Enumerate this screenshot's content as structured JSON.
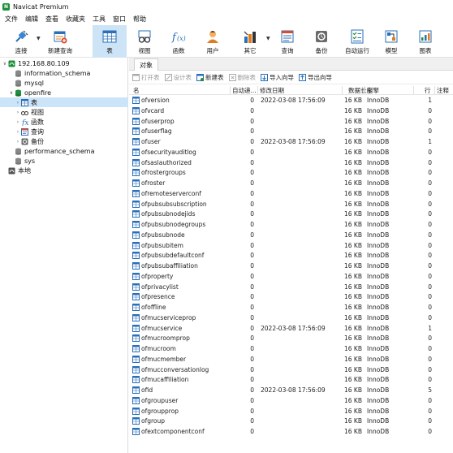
{
  "window": {
    "title": "Navicat Premium"
  },
  "menu": [
    "文件",
    "编辑",
    "查看",
    "收藏夹",
    "工具",
    "窗口",
    "帮助"
  ],
  "toolbar": {
    "connect": "连接",
    "new_query": "新建查询",
    "table": "表",
    "view": "视图",
    "function": "函数",
    "user": "用户",
    "other": "其它",
    "query": "查询",
    "backup": "备份",
    "automation": "自动运行",
    "model": "模型",
    "chart": "图表"
  },
  "sidebar": {
    "connection": "192.168.80.109",
    "databases": {
      "information_schema": "information_schema",
      "mysql": "mysql",
      "openfire": "openfire",
      "performance_schema": "performance_schema",
      "sys": "sys"
    },
    "openfire_children": {
      "tables": "表",
      "views": "视图",
      "functions": "函数",
      "queries": "查询",
      "backups": "备份"
    },
    "local": "本地"
  },
  "main": {
    "tab": "对象",
    "objbar": {
      "open": "打开表",
      "design": "设计表",
      "new": "新建表",
      "delete": "删除表",
      "import": "导入向导",
      "export": "导出向导"
    },
    "columns": {
      "name": "名",
      "auto_inc": "自动递...",
      "modified": "修改日期",
      "data_length": "数据长度",
      "engine": "引擎",
      "rows": "行",
      "comment": "注释"
    },
    "rows": [
      {
        "name": "ofversion",
        "auto": "0",
        "date": "2022-03-08 17:56:09",
        "size": "16 KB",
        "engine": "InnoDB",
        "rows": "1"
      },
      {
        "name": "ofvcard",
        "auto": "0",
        "date": "",
        "size": "16 KB",
        "engine": "InnoDB",
        "rows": "0"
      },
      {
        "name": "ofuserprop",
        "auto": "0",
        "date": "",
        "size": "16 KB",
        "engine": "InnoDB",
        "rows": "0"
      },
      {
        "name": "ofuserflag",
        "auto": "0",
        "date": "",
        "size": "16 KB",
        "engine": "InnoDB",
        "rows": "0"
      },
      {
        "name": "ofuser",
        "auto": "0",
        "date": "2022-03-08 17:56:09",
        "size": "16 KB",
        "engine": "InnoDB",
        "rows": "1"
      },
      {
        "name": "ofsecurityauditlog",
        "auto": "0",
        "date": "",
        "size": "16 KB",
        "engine": "InnoDB",
        "rows": "0"
      },
      {
        "name": "ofsaslauthorized",
        "auto": "0",
        "date": "",
        "size": "16 KB",
        "engine": "InnoDB",
        "rows": "0"
      },
      {
        "name": "ofrostergroups",
        "auto": "0",
        "date": "",
        "size": "16 KB",
        "engine": "InnoDB",
        "rows": "0"
      },
      {
        "name": "ofroster",
        "auto": "0",
        "date": "",
        "size": "16 KB",
        "engine": "InnoDB",
        "rows": "0"
      },
      {
        "name": "ofremoteserverconf",
        "auto": "0",
        "date": "",
        "size": "16 KB",
        "engine": "InnoDB",
        "rows": "0"
      },
      {
        "name": "ofpubsubsubscription",
        "auto": "0",
        "date": "",
        "size": "16 KB",
        "engine": "InnoDB",
        "rows": "0"
      },
      {
        "name": "ofpubsubnodejids",
        "auto": "0",
        "date": "",
        "size": "16 KB",
        "engine": "InnoDB",
        "rows": "0"
      },
      {
        "name": "ofpubsubnodegroups",
        "auto": "0",
        "date": "",
        "size": "16 KB",
        "engine": "InnoDB",
        "rows": "0"
      },
      {
        "name": "ofpubsubnode",
        "auto": "0",
        "date": "",
        "size": "16 KB",
        "engine": "InnoDB",
        "rows": "0"
      },
      {
        "name": "ofpubsubitem",
        "auto": "0",
        "date": "",
        "size": "16 KB",
        "engine": "InnoDB",
        "rows": "0"
      },
      {
        "name": "ofpubsubdefaultconf",
        "auto": "0",
        "date": "",
        "size": "16 KB",
        "engine": "InnoDB",
        "rows": "0"
      },
      {
        "name": "ofpubsubaffiliation",
        "auto": "0",
        "date": "",
        "size": "16 KB",
        "engine": "InnoDB",
        "rows": "0"
      },
      {
        "name": "ofproperty",
        "auto": "0",
        "date": "",
        "size": "16 KB",
        "engine": "InnoDB",
        "rows": "0"
      },
      {
        "name": "ofprivacylist",
        "auto": "0",
        "date": "",
        "size": "16 KB",
        "engine": "InnoDB",
        "rows": "0"
      },
      {
        "name": "ofpresence",
        "auto": "0",
        "date": "",
        "size": "16 KB",
        "engine": "InnoDB",
        "rows": "0"
      },
      {
        "name": "ofoffline",
        "auto": "0",
        "date": "",
        "size": "16 KB",
        "engine": "InnoDB",
        "rows": "0"
      },
      {
        "name": "ofmucserviceprop",
        "auto": "0",
        "date": "",
        "size": "16 KB",
        "engine": "InnoDB",
        "rows": "0"
      },
      {
        "name": "ofmucservice",
        "auto": "0",
        "date": "2022-03-08 17:56:09",
        "size": "16 KB",
        "engine": "InnoDB",
        "rows": "1"
      },
      {
        "name": "ofmucroomprop",
        "auto": "0",
        "date": "",
        "size": "16 KB",
        "engine": "InnoDB",
        "rows": "0"
      },
      {
        "name": "ofmucroom",
        "auto": "0",
        "date": "",
        "size": "16 KB",
        "engine": "InnoDB",
        "rows": "0"
      },
      {
        "name": "ofmucmember",
        "auto": "0",
        "date": "",
        "size": "16 KB",
        "engine": "InnoDB",
        "rows": "0"
      },
      {
        "name": "ofmucconversationlog",
        "auto": "0",
        "date": "",
        "size": "16 KB",
        "engine": "InnoDB",
        "rows": "0"
      },
      {
        "name": "ofmucaffiliation",
        "auto": "0",
        "date": "",
        "size": "16 KB",
        "engine": "InnoDB",
        "rows": "0"
      },
      {
        "name": "ofid",
        "auto": "0",
        "date": "2022-03-08 17:56:09",
        "size": "16 KB",
        "engine": "InnoDB",
        "rows": "5"
      },
      {
        "name": "ofgroupuser",
        "auto": "0",
        "date": "",
        "size": "16 KB",
        "engine": "InnoDB",
        "rows": "0"
      },
      {
        "name": "ofgroupprop",
        "auto": "0",
        "date": "",
        "size": "16 KB",
        "engine": "InnoDB",
        "rows": "0"
      },
      {
        "name": "ofgroup",
        "auto": "0",
        "date": "",
        "size": "16 KB",
        "engine": "InnoDB",
        "rows": "0"
      },
      {
        "name": "ofextcomponentconf",
        "auto": "0",
        "date": "",
        "size": "16 KB",
        "engine": "InnoDB",
        "rows": "0"
      }
    ]
  },
  "colors": {
    "accent": "#1e73c8",
    "selection": "#cce4f7",
    "green": "#1f8f3a"
  }
}
